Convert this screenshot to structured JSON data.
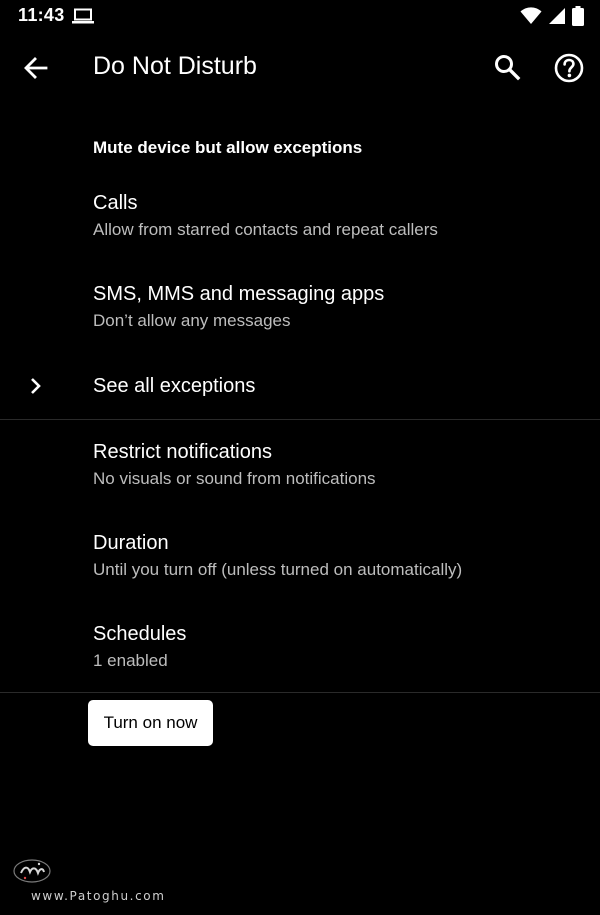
{
  "status_bar": {
    "time": "11:43",
    "icons": [
      "laptop-icon",
      "wifi-icon",
      "signal-icon",
      "battery-icon"
    ]
  },
  "app_bar": {
    "title": "Do Not Disturb",
    "icons": [
      "back-arrow-icon",
      "search-icon",
      "help-icon"
    ]
  },
  "section": {
    "heading": "Mute device but allow exceptions"
  },
  "items": {
    "calls": {
      "title": "Calls",
      "subtitle": "Allow from starred contacts and repeat callers"
    },
    "messages": {
      "title": "SMS, MMS and messaging apps",
      "subtitle": "Don’t allow any messages"
    },
    "exceptions": {
      "title": "See all exceptions"
    },
    "restrict": {
      "title": "Restrict notifications",
      "subtitle": "No visuals or sound from notifications"
    },
    "duration": {
      "title": "Duration",
      "subtitle": "Until you turn off (unless turned on automatically)"
    },
    "schedules": {
      "title": "Schedules",
      "subtitle": "1 enabled"
    }
  },
  "button": {
    "label": "Turn on now"
  },
  "watermark": {
    "url": "www.Patoghu.com"
  },
  "colors": {
    "background": "#000000",
    "primary_text": "#ffffff",
    "secondary_text": "#bdbdbd",
    "divider": "#2a2a2a",
    "button_bg": "#ffffff",
    "button_text": "#000000"
  }
}
